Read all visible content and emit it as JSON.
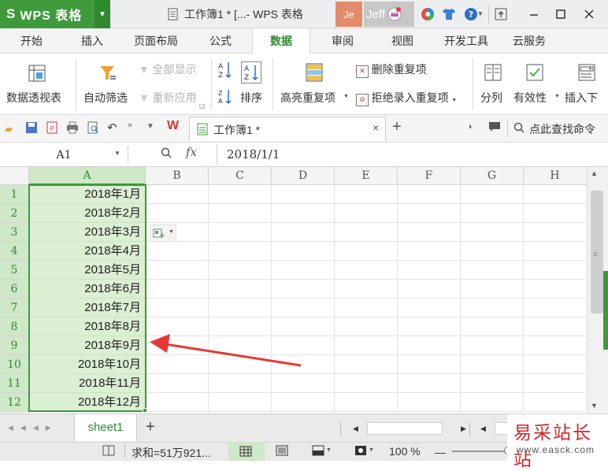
{
  "app": {
    "logo_s": "S",
    "logo_text": "WPS 表格",
    "doc_title": "工作簿1 * [...- WPS 表格",
    "user_initials": "Je",
    "user_name": "Jeff"
  },
  "menu": {
    "tabs": [
      "开始",
      "插入",
      "页面布局",
      "公式",
      "数据",
      "审阅",
      "视图",
      "开发工具",
      "云服务"
    ],
    "active": "数据"
  },
  "ribbon": {
    "pivot": "数据透视表",
    "autofilter": "自动筛选",
    "show_all": "全部显示",
    "reapply": "重新应用",
    "sort": "排序",
    "highlight_dup": "高亮重复项",
    "delete_dup": "删除重复项",
    "reject_dup": "拒绝录入重复项",
    "split": "分列",
    "validity": "有效性",
    "insert_dropdown": "插入下"
  },
  "qat": {
    "doc_tab": "工作簿1 *",
    "find_cmd": "点此查找命令"
  },
  "formula_bar": {
    "name_box": "A1",
    "fx": "fx",
    "value": "2018/1/1"
  },
  "grid": {
    "columns": [
      "A",
      "B",
      "C",
      "D",
      "E",
      "F",
      "G",
      "H"
    ],
    "rows": [
      "1",
      "2",
      "3",
      "4",
      "5",
      "6",
      "7",
      "8",
      "9",
      "10",
      "11",
      "12"
    ],
    "column_a": [
      "2018年1月",
      "2018年2月",
      "2018年3月",
      "2018年4月",
      "2018年5月",
      "2018年6月",
      "2018年7月",
      "2018年8月",
      "2018年9月",
      "2018年10月",
      "2018年11月",
      "2018年12月"
    ]
  },
  "sheets": {
    "active": "sheet1",
    "add": "+"
  },
  "status": {
    "sum": "求和=51万921...",
    "zoom": "100 %"
  },
  "watermark": {
    "text": "易采站长站",
    "url": "www.easck.com"
  },
  "colors": {
    "brand_green": "#3f9a3c",
    "selection_fill": "#dbefd3",
    "selection_border": "#3b9a3b",
    "arrow": "#e53935"
  }
}
